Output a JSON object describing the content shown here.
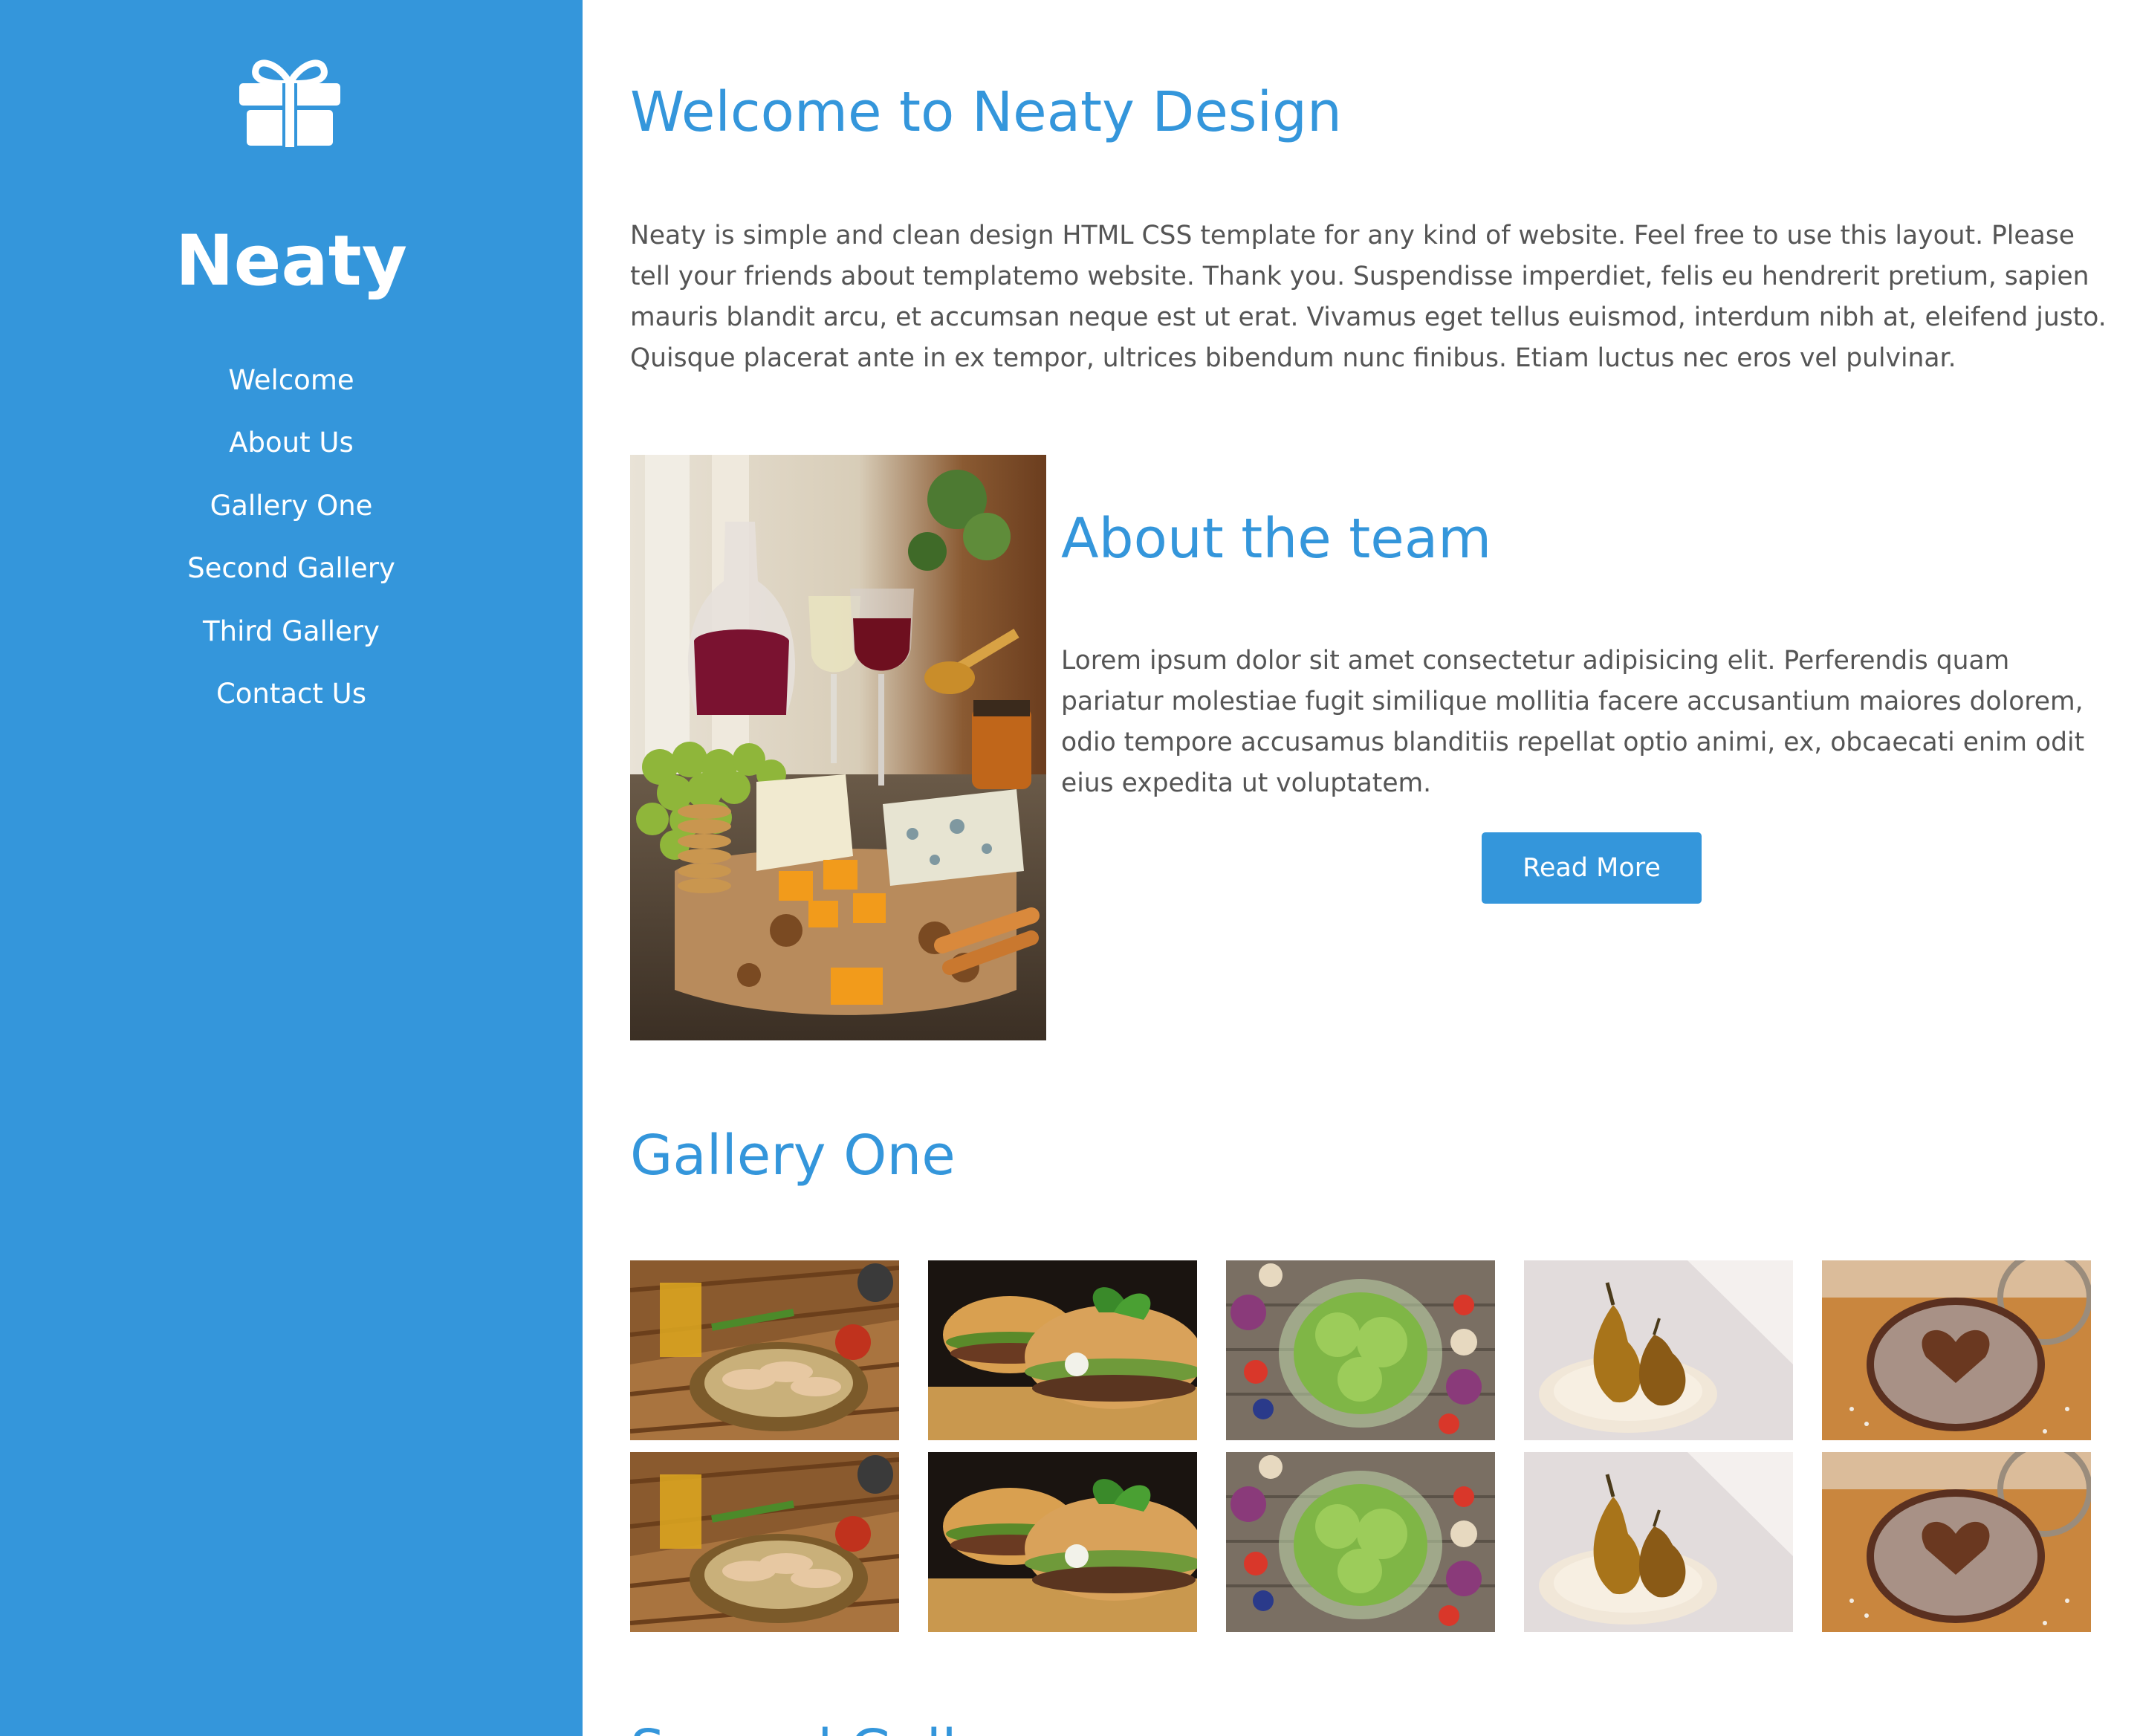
{
  "sidebar": {
    "logo_icon": "gift-icon",
    "brand": "Neaty",
    "nav": [
      {
        "label": "Welcome"
      },
      {
        "label": "About Us"
      },
      {
        "label": "Gallery One"
      },
      {
        "label": "Second Gallery"
      },
      {
        "label": "Third Gallery"
      },
      {
        "label": "Contact Us"
      }
    ]
  },
  "main": {
    "welcome_title": "Welcome to Neaty Design",
    "welcome_text": "Neaty is simple and clean design HTML CSS template for any kind of website. Feel free to use this layout. Please tell your friends about templatemo website. Thank you. Suspendisse imperdiet, felis eu hendrerit pretium, sapien mauris blandit arcu, et accumsan neque est ut erat. Vivamus eget tellus euismod, interdum nibh at, eleifend justo. Quisque placerat ante in ex tempor, ultrices bibendum nunc finibus. Etiam luctus nec eros vel pulvinar.",
    "about_title": "About the team",
    "about_text": "Lorem ipsum dolor sit amet consectetur adipisicing elit. Perferendis quam pariatur molestiae fugit similique mollitia facere accusantium maiores dolorem, odio tempore accusamus blanditiis repellat optio animi, ex, obcaecati enim odit eius expedita ut voluptatem.",
    "read_more": "Read More",
    "gallery_one_title": "Gallery One",
    "second_gallery_title": "Second Gallery",
    "gallery_one": [
      "spring-rolls-tea",
      "burger",
      "salad-bowls",
      "pears",
      "cocoa-cookie",
      "spring-rolls-tea",
      "burger",
      "salad-bowls",
      "pears",
      "cocoa-cookie"
    ]
  },
  "colors": {
    "brand_blue": "#3496db",
    "white": "#ffffff",
    "text_gray": "#555555"
  }
}
